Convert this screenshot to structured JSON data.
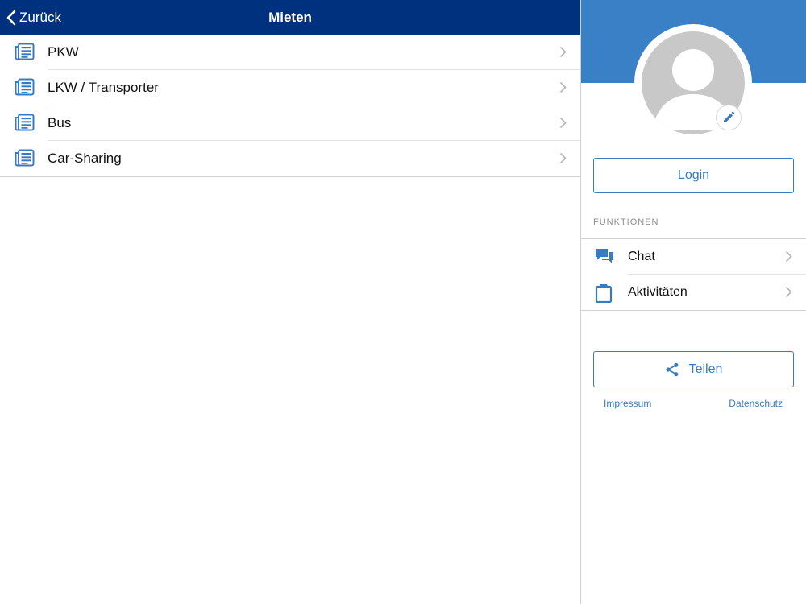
{
  "navbar": {
    "back_label": "Zurück",
    "title": "Mieten"
  },
  "list": {
    "items": [
      {
        "label": "PKW",
        "icon": "newspaper-icon"
      },
      {
        "label": "LKW / Transporter",
        "icon": "newspaper-icon"
      },
      {
        "label": "Bus",
        "icon": "newspaper-icon"
      },
      {
        "label": "Car-Sharing",
        "icon": "newspaper-icon"
      }
    ]
  },
  "profile": {
    "login_label": "Login",
    "section_title": "FUNKTIONEN",
    "functions": [
      {
        "label": "Chat",
        "icon": "chat-bubbles-icon"
      },
      {
        "label": "Aktivitäten",
        "icon": "clipboard-icon"
      }
    ],
    "share_label": "Teilen",
    "links": {
      "impressum": "Impressum",
      "datenschutz": "Datenschutz"
    }
  },
  "colors": {
    "navbar_bg": "#00317f",
    "banner_bg": "#3a80c6",
    "accent": "#3a7bbf"
  }
}
